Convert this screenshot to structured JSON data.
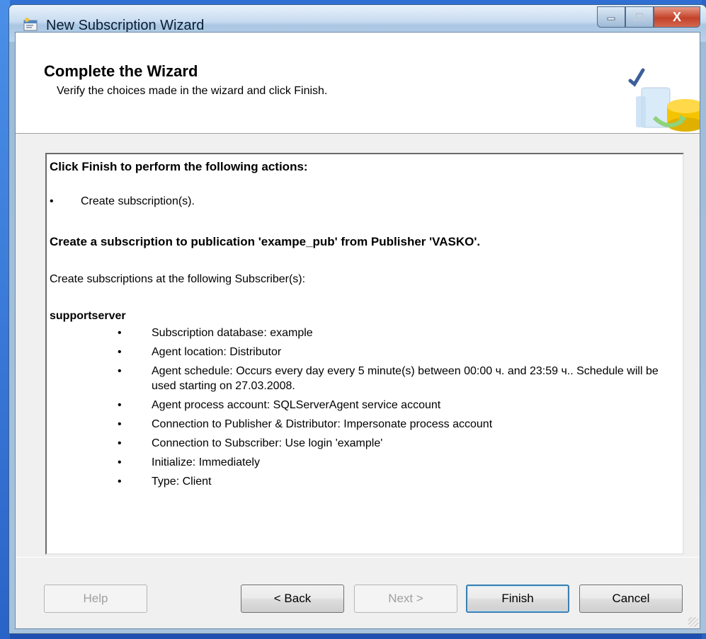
{
  "window": {
    "title": "New Subscription Wizard",
    "controls": {
      "minimize": "–",
      "maximize": "□",
      "close": "X"
    }
  },
  "header": {
    "title": "Complete the Wizard",
    "subtitle": "Verify the choices made in the wizard and click Finish."
  },
  "summary": {
    "heading": "Click Finish to perform the following actions:",
    "actions": [
      "Create subscription(s)."
    ],
    "publication_heading": "Create a subscription to publication 'exampe_pub' from Publisher 'VASKO'.",
    "subscribers_intro": "Create subscriptions at the following Subscriber(s):",
    "subscriber_name": "supportserver",
    "bullet": "•",
    "details": [
      "Subscription database: example",
      "Agent location: Distributor",
      "Agent schedule: Occurs every day every 5 minute(s) between 00:00 ч. and 23:59 ч.. Schedule will be used starting on 27.03.2008.",
      "Agent process account: SQLServerAgent service account",
      "Connection to Publisher & Distributor: Impersonate process account",
      "Connection to Subscriber: Use login 'example'",
      "Initialize: Immediately",
      "Type: Client"
    ]
  },
  "buttons": {
    "help": "Help",
    "back": "< Back",
    "next": "Next >",
    "finish": "Finish",
    "cancel": "Cancel"
  },
  "colors": {
    "desktop": "#2f6fd4",
    "default_button_border": "#3c7fb1"
  }
}
